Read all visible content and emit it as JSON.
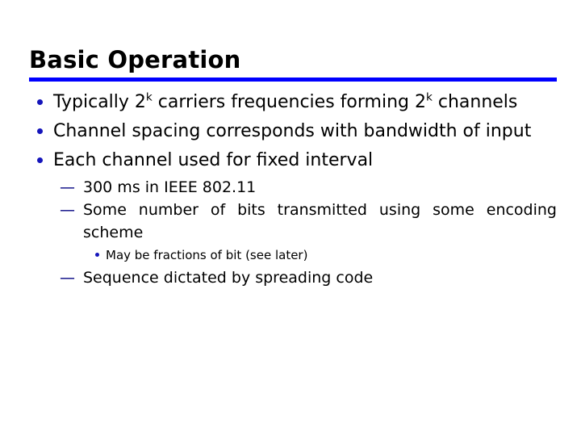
{
  "slide": {
    "title": "Basic Operation",
    "accent_color": "#0000FF",
    "bullet_color": "#1515BB",
    "dash_color": "#000080",
    "text_color": "#000000",
    "background_color": "#FFFFFF",
    "rule": {
      "name": "title-underline-rule",
      "color": "#0000FF"
    },
    "bullets": [
      {
        "level": 1,
        "marker": "bullet-dot",
        "text_before_sup": "Typically 2",
        "sup": "k",
        "text_middle": " carriers frequencies forming 2",
        "sup2": "k",
        "text_after": " channels",
        "full_text": "Typically 2k carriers frequencies forming 2k channels"
      },
      {
        "level": 1,
        "marker": "bullet-dot",
        "full_text": "Channel spacing corresponds with bandwidth of input"
      },
      {
        "level": 1,
        "marker": "bullet-dot",
        "full_text": "Each channel used for fixed interval"
      },
      {
        "level": 2,
        "marker": "—",
        "full_text": "300 ms in IEEE 802.11"
      },
      {
        "level": 2,
        "marker": "—",
        "full_text": "Some number of bits transmitted using some encoding scheme"
      },
      {
        "level": 3,
        "marker": "bullet-dot",
        "full_text": "May be fractions of bit (see later)"
      },
      {
        "level": 2,
        "marker": "—",
        "full_text": "Sequence dictated by spreading code"
      }
    ]
  }
}
